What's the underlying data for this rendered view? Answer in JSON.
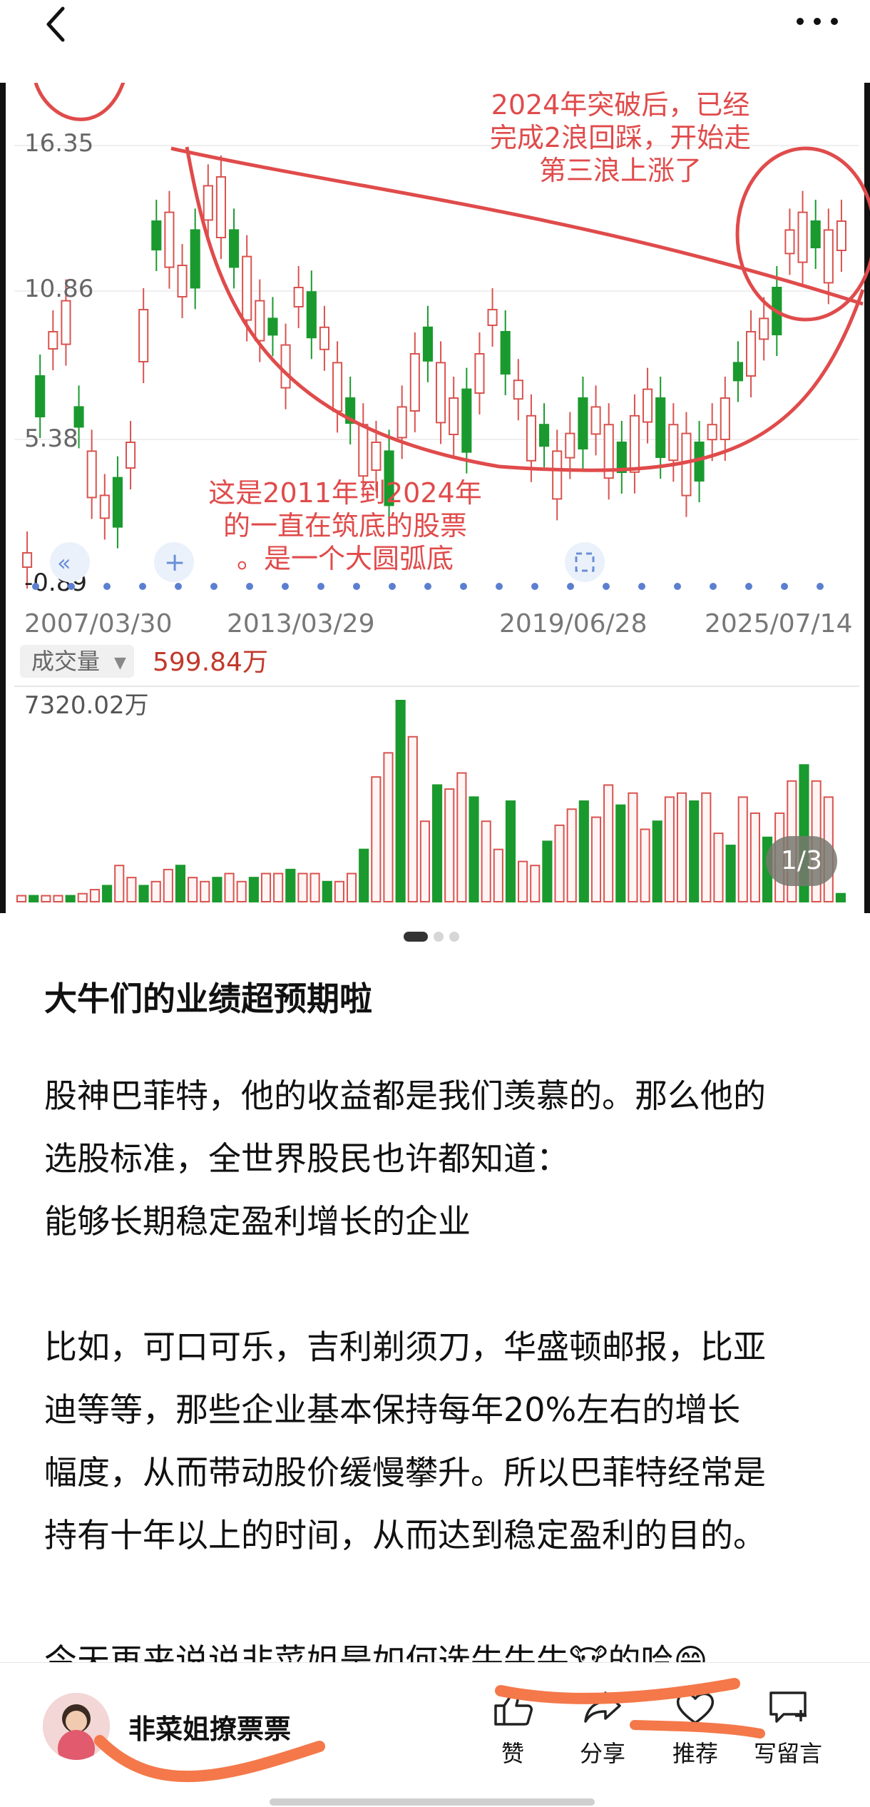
{
  "header": {
    "back_icon": "back-chevron-icon",
    "more_icon": "more-dots-icon"
  },
  "chart": {
    "y_ticks": [
      "16.35",
      "10.86",
      "5.38",
      "-0.89"
    ],
    "x_ticks": [
      "2007/03/30",
      "2013/03/29",
      "2019/06/28",
      "2025/07/14"
    ],
    "volume_selector": "成交量",
    "volume_current": "599.84万",
    "volume_max_label": "7320.02万",
    "annotation_top": [
      "2024年突破后，已经",
      "完成2浪回踩，开始走",
      "第三浪上涨了"
    ],
    "annotation_bottom": [
      "这是2011年到2024年",
      "的一直在筑底的股票",
      "。是一个大圆弧底"
    ],
    "annotation_color": "#e04b4b",
    "up_color": "#d9534f",
    "down_color": "#1a9a2e"
  },
  "chart_data": {
    "type": "candlestick",
    "y_ticks": [
      16.35,
      10.86,
      5.38,
      -0.89
    ],
    "x_ticks": [
      "2007/03/30",
      "2013/03/29",
      "2019/06/28",
      "2025/07/14"
    ],
    "volume_max": "7320.02万",
    "volume_current": "599.84万"
  },
  "pager": {
    "badge": "1/3"
  },
  "article": {
    "title": "大牛们的业绩超预期啦",
    "para1": [
      "股神巴菲特，他的收益都是我们羡慕的。那么他的",
      "选股标准，全世界股民也许都知道：",
      "能够长期稳定盈利增长的企业"
    ],
    "para2": [
      "比如，可口可乐，吉利剃须刀，华盛顿邮报，比亚",
      "迪等等，那些企业基本保持每年20%左右的增长",
      "幅度，从而带动股价缓慢攀升。所以巴菲特经常是",
      "持有十年以上的时间，从而达到稳定盈利的目的。"
    ],
    "para3": "今天再来说说非菜姐是如何选牛牛牛🐮的哈😁"
  },
  "bottom": {
    "author": "非菜姐撩票票",
    "like": "赞",
    "share": "分享",
    "recommend": "推荐",
    "comment": "写留言"
  }
}
